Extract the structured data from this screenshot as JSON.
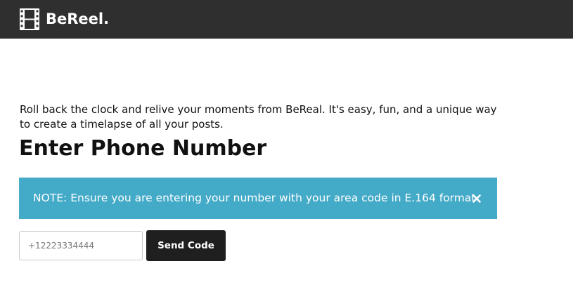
{
  "header": {
    "brand_name": "BeReel.",
    "logo_icon": "film-strip-icon",
    "background_color": "#2f2f2f"
  },
  "main": {
    "intro_text": "Roll back the clock and relive your moments from BeReal. It's easy, fun, and a unique way to create a timelapse of all your posts.",
    "title": "Enter Phone Number",
    "alert": {
      "text": "NOTE: Ensure you are entering your number with your area code in E.164 format",
      "close_icon": "close-icon",
      "background_color": "#43aac8"
    },
    "form": {
      "phone_placeholder": "+12223334444",
      "phone_value": "",
      "send_label": "Send Code"
    }
  }
}
